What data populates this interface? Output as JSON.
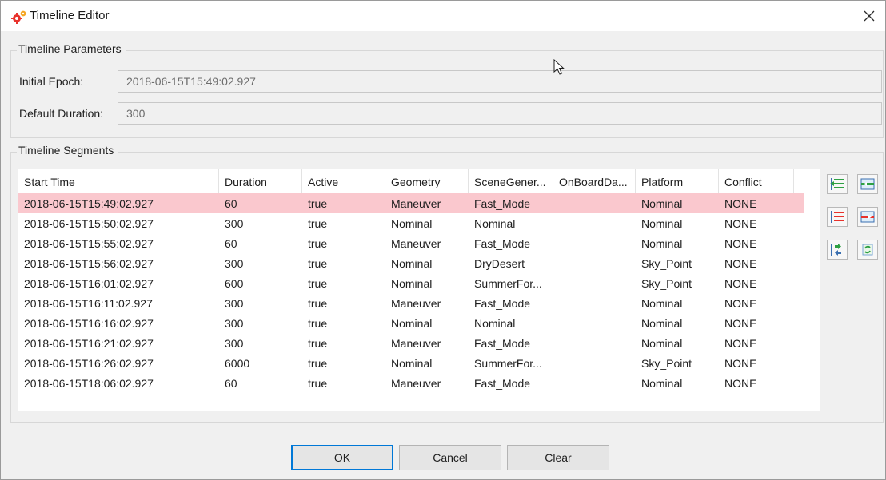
{
  "window": {
    "title": "Timeline Editor",
    "close_glyph": "✕"
  },
  "parameters": {
    "group_title": "Timeline Parameters",
    "initial_epoch_label": "Initial Epoch:",
    "initial_epoch_value": "2018-06-15T15:49:02.927",
    "default_duration_label": "Default Duration:",
    "default_duration_value": "300"
  },
  "segments": {
    "group_title": "Timeline Segments",
    "columns": [
      "Start Time",
      "Duration",
      "Active",
      "Geometry",
      "SceneGener...",
      "OnBoardDa...",
      "Platform",
      "Conflict"
    ],
    "selected_row": 0,
    "rows": [
      [
        "2018-06-15T15:49:02.927",
        "60",
        "true",
        "Maneuver",
        "Fast_Mode",
        "",
        "Nominal",
        "NONE"
      ],
      [
        "2018-06-15T15:50:02.927",
        "300",
        "true",
        "Nominal",
        "Nominal",
        "",
        "Nominal",
        "NONE"
      ],
      [
        "2018-06-15T15:55:02.927",
        "60",
        "true",
        "Maneuver",
        "Fast_Mode",
        "",
        "Nominal",
        "NONE"
      ],
      [
        "2018-06-15T15:56:02.927",
        "300",
        "true",
        "Nominal",
        "DryDesert",
        "",
        "Sky_Point",
        "NONE"
      ],
      [
        "2018-06-15T16:01:02.927",
        "600",
        "true",
        "Nominal",
        "SummerFor...",
        "",
        "Sky_Point",
        "NONE"
      ],
      [
        "2018-06-15T16:11:02.927",
        "300",
        "true",
        "Maneuver",
        "Fast_Mode",
        "",
        "Nominal",
        "NONE"
      ],
      [
        "2018-06-15T16:16:02.927",
        "300",
        "true",
        "Nominal",
        "Nominal",
        "",
        "Nominal",
        "NONE"
      ],
      [
        "2018-06-15T16:21:02.927",
        "300",
        "true",
        "Maneuver",
        "Fast_Mode",
        "",
        "Nominal",
        "NONE"
      ],
      [
        "2018-06-15T16:26:02.927",
        "6000",
        "true",
        "Nominal",
        "SummerFor...",
        "",
        "Sky_Point",
        "NONE"
      ],
      [
        "2018-06-15T18:06:02.927",
        "60",
        "true",
        "Maneuver",
        "Fast_Mode",
        "",
        "Nominal",
        "NONE"
      ]
    ]
  },
  "side_toolbar": [
    "insert-row-above-icon",
    "add-row-icon",
    "remove-row-icon",
    "delete-row-icon",
    "move-row-icon",
    "refresh-row-icon"
  ],
  "buttons": {
    "ok": "OK",
    "cancel": "Cancel",
    "clear": "Clear"
  },
  "colors": {
    "selection": "#fac8ce",
    "accent": "#0078d7",
    "icon_red": "#e8322c",
    "icon_green": "#2ea043"
  }
}
